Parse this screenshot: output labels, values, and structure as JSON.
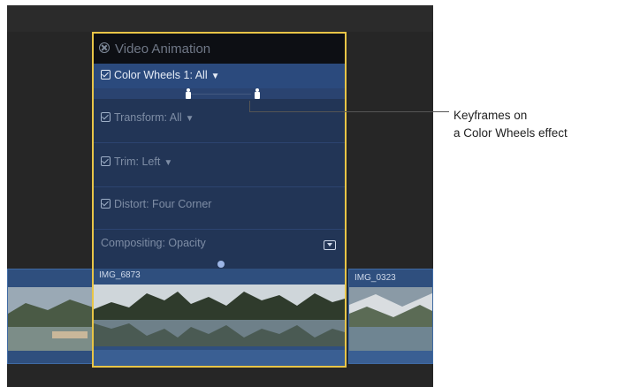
{
  "editor": {
    "title": "Video Animation",
    "rows": [
      {
        "label": "Color Wheels 1: All",
        "has_menu": true
      },
      {
        "label": "Transform: All",
        "has_menu": true
      },
      {
        "label": "Trim: Left",
        "has_menu": true
      },
      {
        "label": "Distort: Four Corner",
        "has_menu": false
      },
      {
        "label": "Compositing: Opacity",
        "has_menu": false
      }
    ],
    "keyframe_count": 2
  },
  "clips": {
    "main_name": "IMG_6873",
    "right_name": "IMG_0323"
  },
  "callout": {
    "line1": "Keyframes on",
    "line2": "a Color Wheels effect"
  },
  "colors": {
    "selection": "#e8c547",
    "editor_bg": "#223556",
    "clip": "#2f4f7e"
  }
}
